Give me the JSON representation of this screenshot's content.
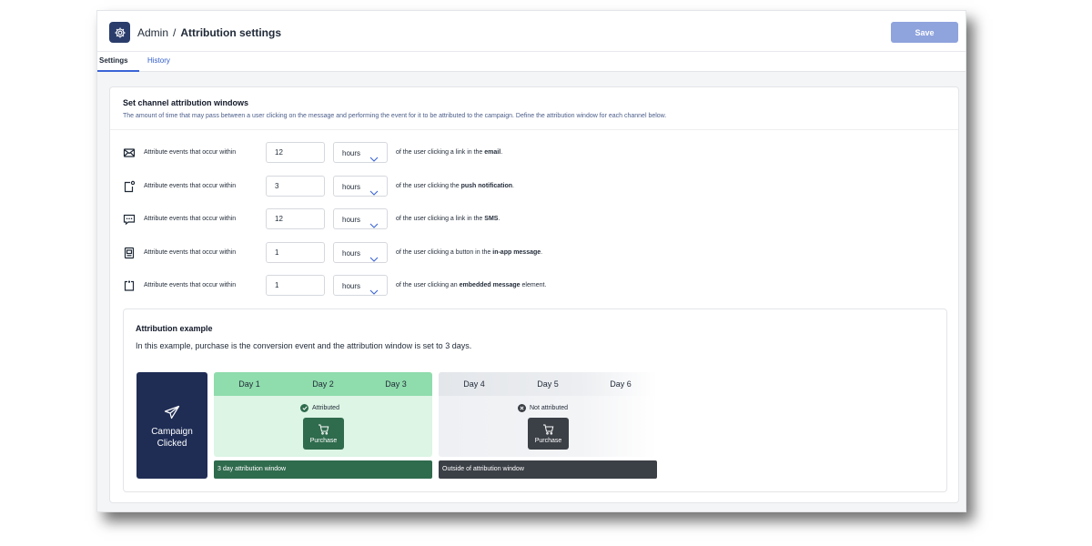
{
  "header": {
    "breadcrumb_parent": "Admin",
    "breadcrumb_separator": "/",
    "breadcrumb_current": "Attribution settings",
    "save_label": "Save",
    "app_icon": "gear-icon"
  },
  "tabs": [
    {
      "label": "Settings",
      "active": true
    },
    {
      "label": "History",
      "active": false
    }
  ],
  "section": {
    "title": "Set channel attribution windows",
    "description": "The amount of time that may pass between a user clicking on the message and performing the event for it to be attributed to the campaign. Define the attribution window for each channel below."
  },
  "rows": [
    {
      "icon": "email-icon",
      "label": "Attribute events that occur within",
      "value": "12",
      "unit": "hours",
      "suffix_pre": "of the user clicking a link in the",
      "suffix_bold": "email",
      "suffix_post": "."
    },
    {
      "icon": "push-notification-icon",
      "label": "Attribute events that occur within",
      "value": "3",
      "unit": "hours",
      "suffix_pre": "of the user clicking the",
      "suffix_bold": "push notification",
      "suffix_post": "."
    },
    {
      "icon": "sms-icon",
      "label": "Attribute events that occur within",
      "value": "12",
      "unit": "hours",
      "suffix_pre": "of the user clicking a link in the",
      "suffix_bold": "SMS",
      "suffix_post": "."
    },
    {
      "icon": "in-app-message-icon",
      "label": "Attribute events that occur within",
      "value": "1",
      "unit": "hours",
      "suffix_pre": "of the user clicking a button in the",
      "suffix_bold": "in-app message",
      "suffix_post": "."
    },
    {
      "icon": "embedded-message-icon",
      "label": "Attribute events that occur within",
      "value": "1",
      "unit": "hours",
      "suffix_pre": "of the user clicking an",
      "suffix_bold": "embedded message",
      "suffix_post": " element."
    }
  ],
  "example": {
    "title": "Attribution example",
    "description": "In this example, purchase is the conversion event and the attribution window is set to 3 days.",
    "campaign_label_line1": "Campaign",
    "campaign_label_line2": "Clicked",
    "attributed_days": [
      "Day 1",
      "Day 2",
      "Day 3"
    ],
    "outside_days": [
      "Day 4",
      "Day 5",
      "Day 6"
    ],
    "attributed_status": "Attributed",
    "not_attributed_status": "Not attributed",
    "purchase_label": "Purchase",
    "window_bar_label": "3 day attribution window",
    "outside_bar_label": "Outside of attribution window"
  },
  "colors": {
    "primary_navy": "#1f2d55",
    "save_button": "#8fa3dd",
    "attributed_light": "#dcf5e4",
    "attributed_head": "#8fdcac",
    "attributed_dark": "#2f6b4d",
    "outside_dark": "#3b3f46",
    "link_blue": "#2f5bcc"
  }
}
